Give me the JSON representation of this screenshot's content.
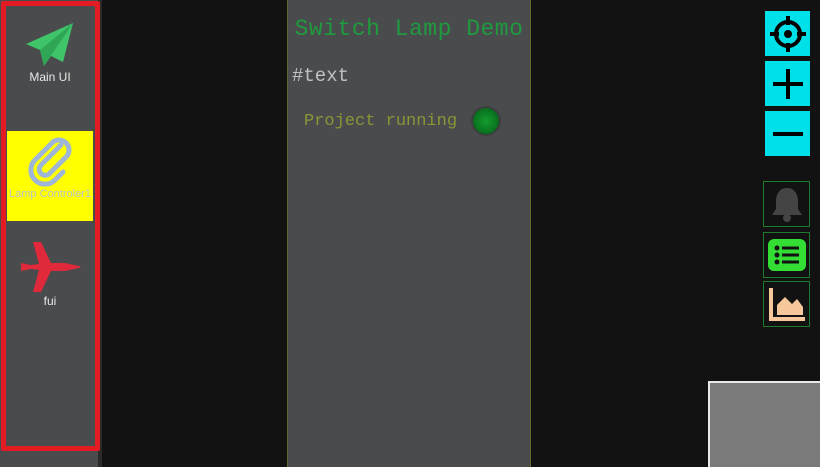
{
  "sidebar": {
    "items": [
      {
        "label": "Main UI",
        "icon": "paper-plane-icon",
        "color": "#3fc46a"
      },
      {
        "label": "Lamp Controler1",
        "icon": "paperclip-icon",
        "color": "#9fb6d6",
        "active": true,
        "active_bg": "#ffff00"
      },
      {
        "label": "fui",
        "icon": "fighter-jet-icon",
        "color": "#e0293a"
      }
    ],
    "highlight_color": "#e31b23"
  },
  "panel": {
    "title": "Switch Lamp Demo",
    "text": "#text",
    "status_text": "Project running",
    "status_led_color": "#139b2e"
  },
  "controls": {
    "accent": "#00e0e8",
    "map_buttons": [
      "crosshairs-icon",
      "plus-icon",
      "minus-icon"
    ],
    "tool_buttons": [
      {
        "icon": "bell-icon",
        "color": "#444444"
      },
      {
        "icon": "list-icon",
        "color": "#33dd33"
      },
      {
        "icon": "area-chart-icon",
        "color": "#f5c79a"
      }
    ]
  }
}
